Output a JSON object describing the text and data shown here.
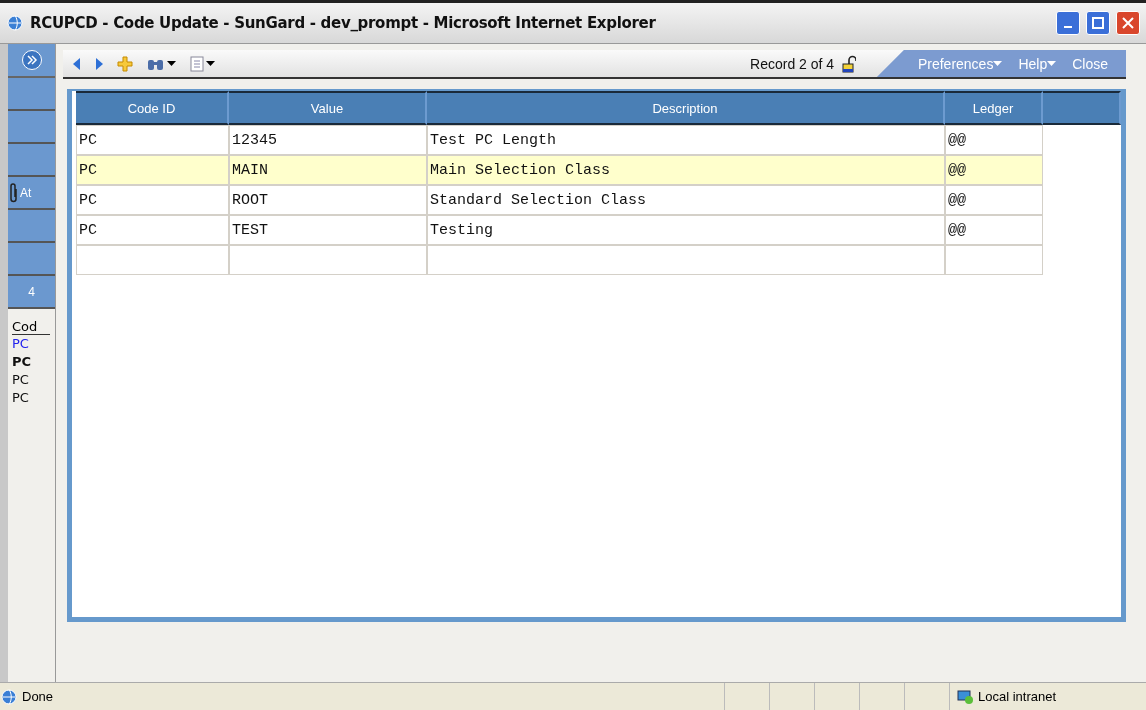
{
  "window": {
    "title": "RCUPCD - Code Update - SunGard - dev_prompt - Microsoft Internet Explorer"
  },
  "sidebar": {
    "buttons": [
      {
        "kind": "plain"
      },
      {
        "kind": "plain"
      },
      {
        "kind": "plain"
      },
      {
        "label": "At",
        "kind": "attach"
      },
      {
        "kind": "plain"
      },
      {
        "kind": "plain"
      },
      {
        "label": "4",
        "kind": "plain"
      }
    ],
    "list_header": "Cod",
    "items": [
      {
        "label": "PC",
        "highlighted": true,
        "selected": false
      },
      {
        "label": "PC",
        "highlighted": false,
        "selected": true
      },
      {
        "label": "PC",
        "highlighted": false,
        "selected": false
      },
      {
        "label": "PC",
        "highlighted": false,
        "selected": false
      }
    ]
  },
  "toolbar": {
    "record": "Record 2 of 4",
    "locked": false,
    "menu": [
      {
        "label": "Preferences",
        "dropdown": true
      },
      {
        "label": "Help",
        "dropdown": true
      },
      {
        "label": "Close",
        "dropdown": false
      }
    ]
  },
  "table": {
    "columns": [
      "Code ID",
      "Value",
      "Description",
      "Ledger"
    ],
    "rows": [
      {
        "cells": [
          "PC",
          "12345",
          "Test PC Length",
          "@@"
        ],
        "selected": false
      },
      {
        "cells": [
          "PC",
          "MAIN",
          "Main Selection Class",
          "@@"
        ],
        "selected": true
      },
      {
        "cells": [
          "PC",
          "ROOT",
          "Standard Selection Class",
          "@@"
        ],
        "selected": false
      },
      {
        "cells": [
          "PC",
          "TEST",
          "Testing",
          "@@"
        ],
        "selected": false
      }
    ]
  },
  "status_bar": {
    "text": "Done",
    "zone": "Local intranet"
  }
}
